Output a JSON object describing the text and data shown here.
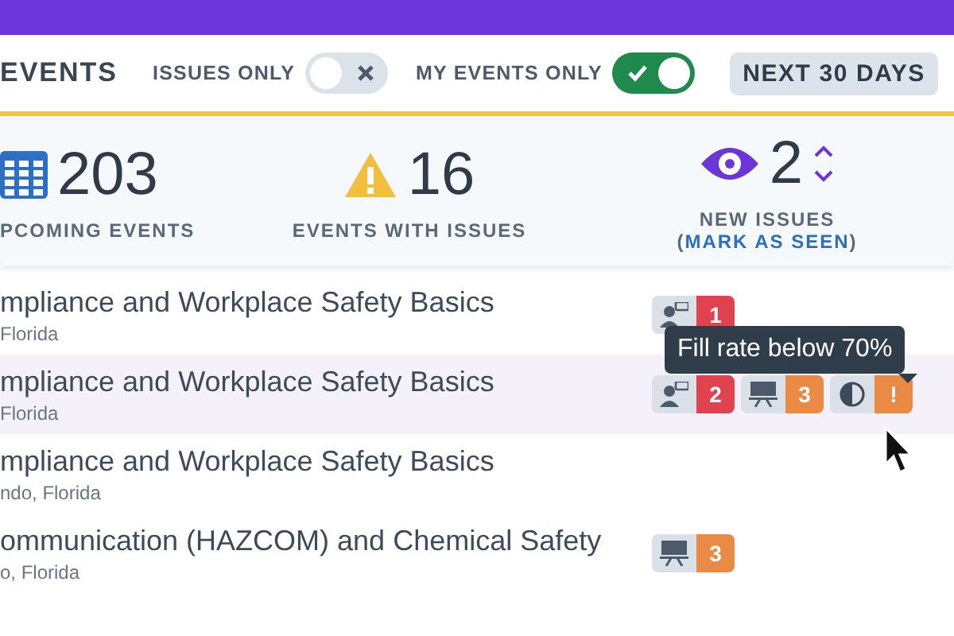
{
  "toolbar": {
    "title": "EVENTS",
    "filters": [
      {
        "label": "ISSUES ONLY",
        "on": false
      },
      {
        "label": "MY EVENTS ONLY",
        "on": true
      }
    ],
    "range_button": "NEXT 30 DAYS"
  },
  "stats": [
    {
      "kind": "calendar",
      "value": "203",
      "label": "PCOMING EVENTS"
    },
    {
      "kind": "warning",
      "value": "16",
      "label": "EVENTS WITH ISSUES"
    },
    {
      "kind": "new",
      "value": "2",
      "label": "NEW ISSUES",
      "link": "MARK AS SEEN",
      "link_brackets": [
        "(",
        ")"
      ]
    }
  ],
  "events": [
    {
      "title": "mpliance and Workplace Safety Basics",
      "location": "Florida",
      "selected": false,
      "badges": [
        {
          "kind": "instructor",
          "count": "1",
          "color": "#e0424f"
        }
      ]
    },
    {
      "title": "mpliance and Workplace Safety Basics",
      "location": "Florida",
      "selected": true,
      "badges": [
        {
          "kind": "instructor",
          "count": "2",
          "color": "#e0424f"
        },
        {
          "kind": "classroom",
          "count": "3",
          "color": "#ea8a45"
        },
        {
          "kind": "fill",
          "count": "!",
          "color": "#ea8a45"
        }
      ]
    },
    {
      "title": "mpliance and Workplace Safety Basics",
      "location": "ndo, Florida",
      "selected": false
    },
    {
      "title": "ommunication (HAZCOM) and Chemical Safety",
      "location": "o, Florida",
      "selected": false,
      "badges": [
        {
          "kind": "classroom",
          "count": "3",
          "color": "#ea8a45"
        }
      ]
    }
  ],
  "tooltip": "Fill rate below 70%"
}
